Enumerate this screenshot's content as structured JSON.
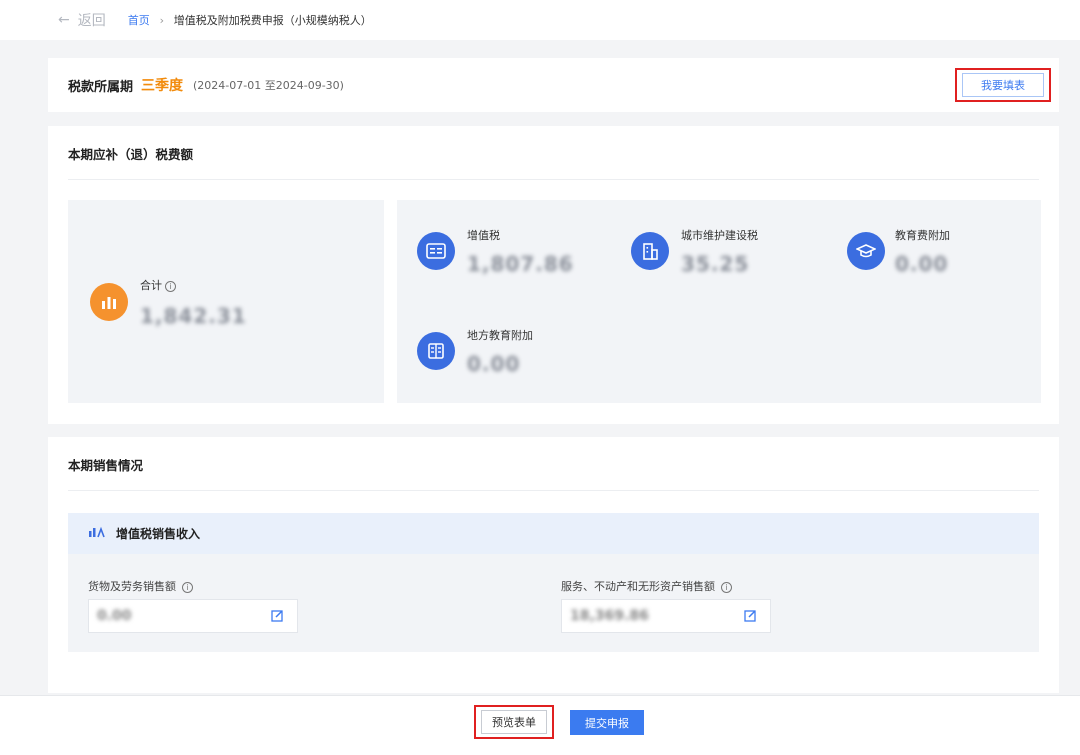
{
  "topbar": {
    "back_arrow": "←",
    "back_label": "返回",
    "breadcrumb_home": "首页",
    "breadcrumb_sep": "›",
    "breadcrumb_current": "增值税及附加税费申报（小规模纳税人）"
  },
  "period": {
    "label": "税款所属期",
    "quarter": "三季度",
    "range": "(2024-07-01 至2024-09-30)",
    "fill_button": "我要填表"
  },
  "tax_section": {
    "title": "本期应补（退）税费额",
    "total": {
      "label": "合计",
      "value": "1,842.31",
      "icon": "bar-chart-icon"
    },
    "items": [
      {
        "label": "增值税",
        "value": "1,807.86",
        "icon": "tax-icon"
      },
      {
        "label": "城市维护建设税",
        "value": "35.25",
        "icon": "building-icon"
      },
      {
        "label": "教育费附加",
        "value": "0.00",
        "icon": "graduation-cap-icon"
      },
      {
        "label": "地方教育附加",
        "value": "0.00",
        "icon": "ledger-icon"
      }
    ]
  },
  "sales_section": {
    "title": "本期销售情况",
    "subsection_title": "增值税销售收入",
    "fields": [
      {
        "label": "货物及劳务销售额",
        "value": "0.00"
      },
      {
        "label": "服务、不动产和无形资产销售额",
        "value": "18,369.86"
      }
    ]
  },
  "footer": {
    "preview_button": "预览表单",
    "submit_button": "提交申报"
  },
  "colors": {
    "accent_blue": "#3b7bf0",
    "accent_orange": "#f28b0c",
    "highlight_red": "#e02020"
  }
}
